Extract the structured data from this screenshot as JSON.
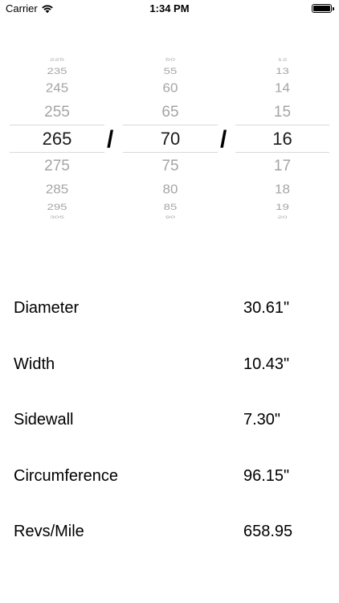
{
  "status_bar": {
    "carrier": "Carrier",
    "time": "1:34 PM"
  },
  "picker": {
    "separator": "/",
    "columns": [
      {
        "name": "width",
        "above": [
          "225",
          "235",
          "245",
          "255"
        ],
        "selected": "265",
        "below": [
          "275",
          "285",
          "295",
          "305"
        ]
      },
      {
        "name": "ratio",
        "above": [
          "50",
          "55",
          "60",
          "65"
        ],
        "selected": "70",
        "below": [
          "75",
          "80",
          "85",
          "90"
        ]
      },
      {
        "name": "rim",
        "above": [
          "12",
          "13",
          "14",
          "15"
        ],
        "selected": "16",
        "below": [
          "17",
          "18",
          "19",
          "20"
        ]
      }
    ]
  },
  "results": [
    {
      "label": "Diameter",
      "value": "30.61\""
    },
    {
      "label": "Width",
      "value": "10.43\""
    },
    {
      "label": "Sidewall",
      "value": "7.30\""
    },
    {
      "label": "Circumference",
      "value": "96.15\""
    },
    {
      "label": "Revs/Mile",
      "value": "658.95"
    }
  ]
}
